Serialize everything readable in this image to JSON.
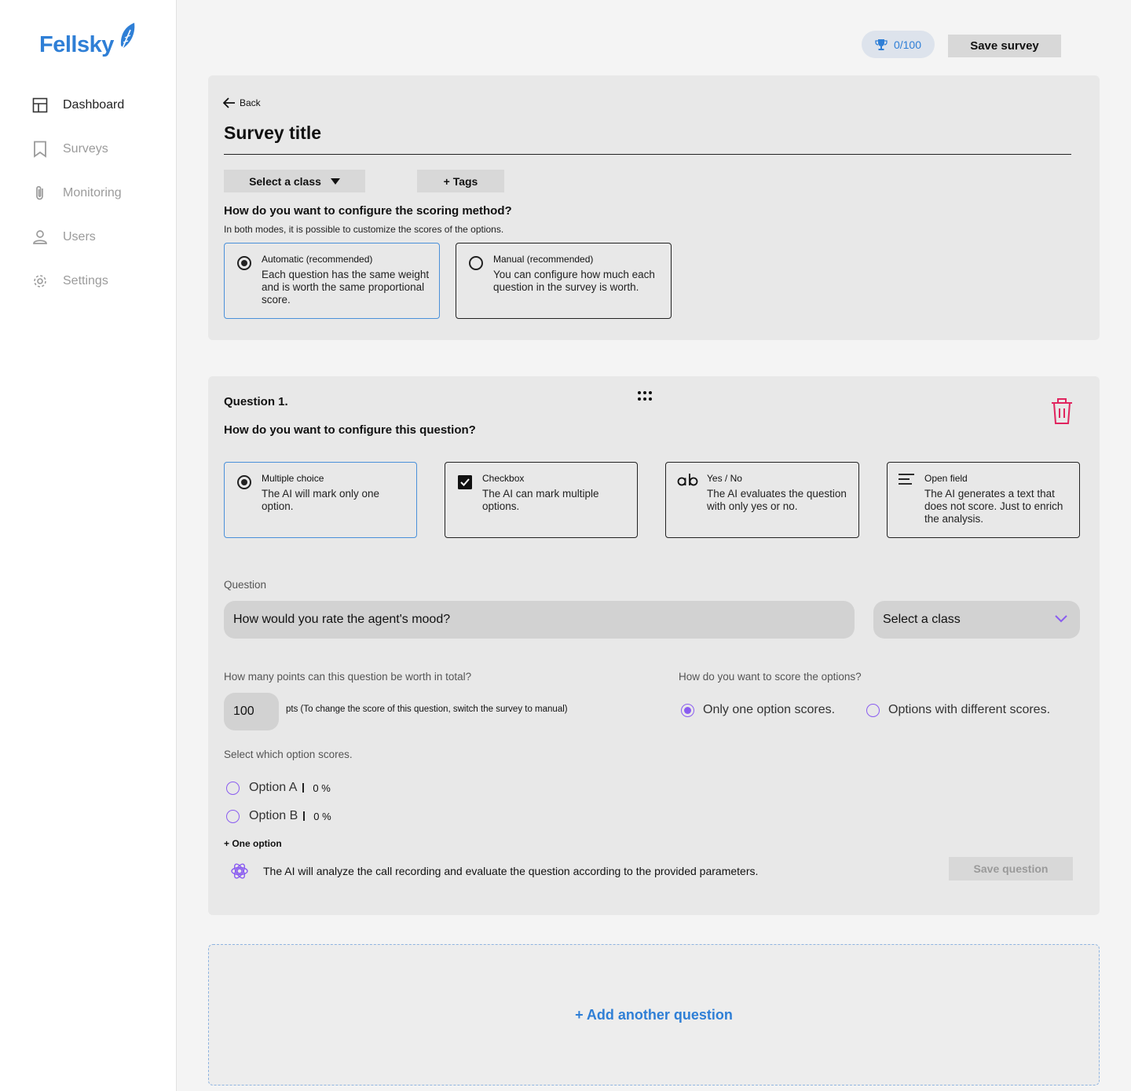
{
  "app": {
    "name": "Fellsky"
  },
  "sidebar": {
    "items": [
      {
        "label": "Dashboard",
        "icon": "dashboard-icon",
        "active": true
      },
      {
        "label": "Surveys",
        "icon": "bookmark-icon",
        "active": false
      },
      {
        "label": "Monitoring",
        "icon": "paperclip-icon",
        "active": false
      },
      {
        "label": "Users",
        "icon": "user-icon",
        "active": false
      },
      {
        "label": "Settings",
        "icon": "gear-icon",
        "active": false
      }
    ]
  },
  "topbar": {
    "score": "0/100",
    "save_label": "Save survey"
  },
  "survey": {
    "back_label": "Back",
    "title": "Survey title",
    "class_select": "Select a class",
    "tags_label": "+ Tags",
    "scoring_question": "How do you want to configure the scoring method?",
    "scoring_hint": "In both modes, it is possible to customize the scores of the options.",
    "scoring_modes": [
      {
        "title": "Automatic (recommended)",
        "desc": "Each question has the same weight and is worth the same proportional score.",
        "selected": true
      },
      {
        "title": "Manual (recommended)",
        "desc": "You can configure how much each question in the survey is worth.",
        "selected": false
      }
    ]
  },
  "question": {
    "number_label": "Question 1.",
    "config_heading": "How do you want to configure this question?",
    "types": [
      {
        "title": "Multiple choice",
        "desc": "The AI will mark only one option.",
        "icon": "radio-icon",
        "selected": true
      },
      {
        "title": "Checkbox",
        "desc": "The AI can mark multiple options.",
        "icon": "checkbox-icon",
        "selected": false
      },
      {
        "title": "Yes / No",
        "desc": "The AI evaluates the question with only yes or no.",
        "icon": "ab-icon",
        "selected": false
      },
      {
        "title": "Open field",
        "desc": "The AI generates a text that does not score. Just to enrich the analysis.",
        "icon": "lines-icon",
        "selected": false
      }
    ],
    "field_label": "Question",
    "text": "How would you rate the agent's mood?",
    "class_select": "Select a class",
    "points_question": "How many points can this question be worth in total?",
    "points": "100",
    "points_note": "pts (To change the score of this question, switch the survey to manual)",
    "score_method_question": "How do you want to score the options?",
    "score_methods": [
      {
        "label": "Only one option scores.",
        "selected": true
      },
      {
        "label": "Options with different scores.",
        "selected": false
      }
    ],
    "select_scoring_label": "Select which option scores.",
    "options": [
      {
        "label": "Option A",
        "percent": "0 %"
      },
      {
        "label": "Option B",
        "percent": "0 %"
      }
    ],
    "add_option_label": "+ One option",
    "ai_note": "The AI will analyze the call recording and evaluate the question according to the provided parameters.",
    "save_label": "Save question"
  },
  "add_question_label": "+ Add another question",
  "colors": {
    "brand": "#2f7fd6",
    "accent_purple": "#8a5cf0",
    "danger": "#e0245e",
    "selected_border": "#4a90d9"
  }
}
